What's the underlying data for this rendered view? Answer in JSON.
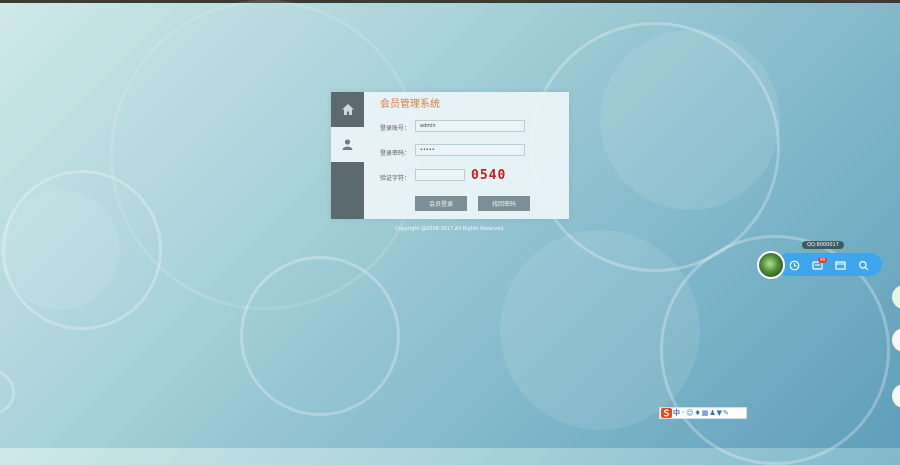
{
  "login": {
    "title": "会员管理系统",
    "account_label": "登录账号：",
    "account_value": "admin",
    "password_label": "登录密码：",
    "password_value": "•••••",
    "captcha_label": "验证字符：",
    "captcha_value": "",
    "captcha_code": "0540",
    "login_button": "会员登录",
    "reset_button": "找回密码"
  },
  "footer": {
    "copyright": "Copyright @2008-2017,All Rights Reserved."
  },
  "qq_widget": {
    "tooltip": "QQ:8000017",
    "badge": "99"
  },
  "ime": {
    "mode": "中"
  },
  "colors": {
    "accent": "#e8793a",
    "sidebar": "#5b6a70",
    "button": "#7b8f97",
    "captcha": "#c41f1f",
    "qq_bar": "#3ea6ef"
  },
  "icons": {
    "home": "home-icon",
    "user": "user-icon",
    "history": "clock-icon",
    "message": "message-icon",
    "window": "window-icon",
    "search": "search-icon"
  }
}
